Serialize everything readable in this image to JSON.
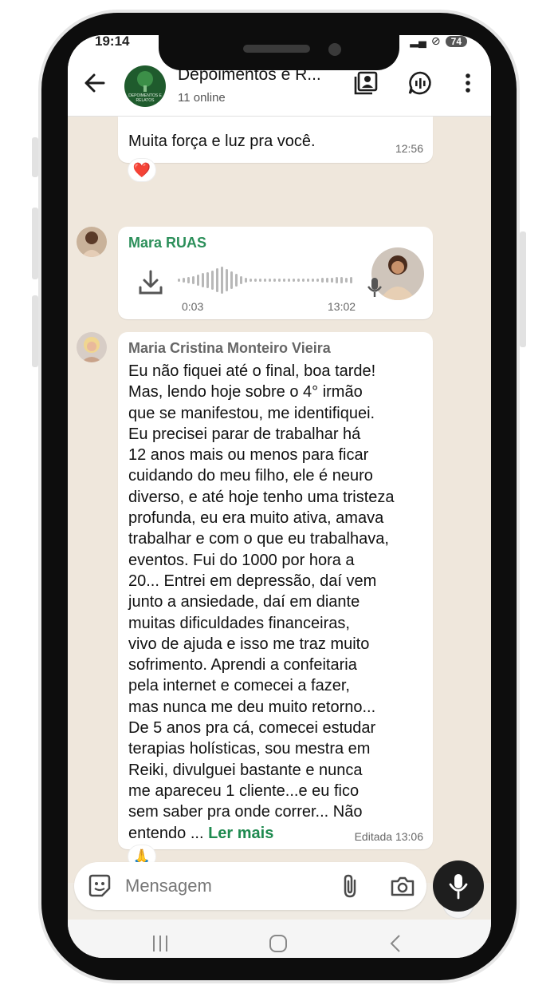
{
  "status": {
    "time": "19:14",
    "battery": "74"
  },
  "header": {
    "title": "Depoimentos e R...",
    "subtitle": "11 online",
    "avatar_text": "DEPOIMENTOS E RELATOS"
  },
  "messages": [
    {
      "text": "Muita força e luz pra você.",
      "time": "12:56",
      "reaction": "❤️"
    },
    {
      "sender": "Mara RUAS",
      "audio_elapsed": "0:03",
      "time": "13:02"
    },
    {
      "sender": "Maria Cristina Monteiro Vieira",
      "lines": [
        "Eu não fiquei até o final, boa tarde!",
        "Mas, lendo hoje sobre o 4° irmão",
        "que se manifestou, me identifiquei.",
        "Eu precisei parar de trabalhar há",
        "12 anos mais ou menos para ficar",
        "cuidando do meu filho, ele é neuro",
        "diverso, e até hoje tenho uma tristeza",
        "profunda, eu era muito ativa, amava",
        "trabalhar e com o que eu trabalhava,",
        "eventos. Fui do 1000 por hora a",
        "20... Entrei em depressão, daí vem",
        "junto a ansiedade, daí em diante",
        "muitas dificuldades financeiras,",
        "vivo de ajuda e isso me traz muito",
        "sofrimento. Aprendi a confeitaria",
        "pela internet e comecei a fazer,",
        "mas nunca me deu muito retorno...",
        "De 5 anos pra cá, comecei estudar",
        "terapias holísticas, sou mestra em",
        "Reiki, divulguei bastante e nunca",
        "me apareceu 1 cliente...e eu fico",
        "sem saber pra onde correr... Não"
      ],
      "last_line_prefix": "entendo ... ",
      "read_more": "Ler mais",
      "time": "Editada 13:06",
      "reaction": "🙏"
    }
  ],
  "input": {
    "placeholder": "Mensagem"
  }
}
